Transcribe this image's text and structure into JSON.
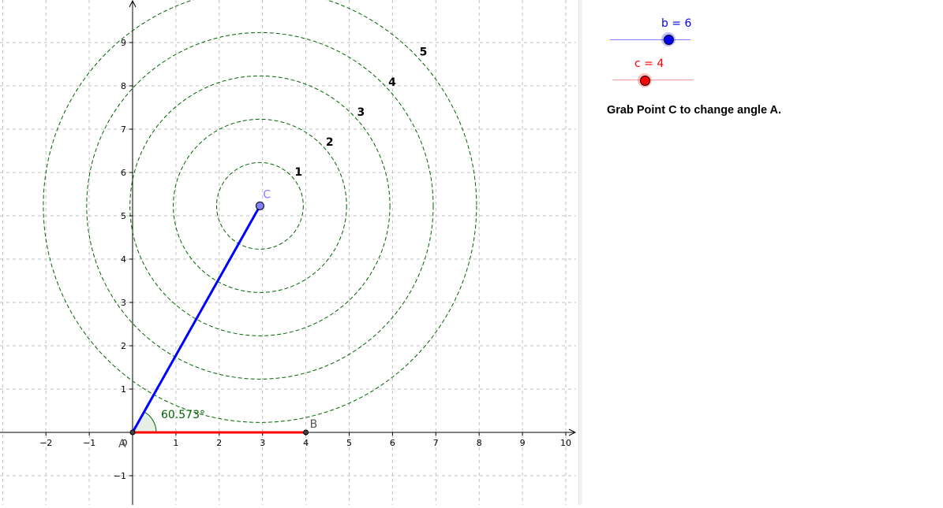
{
  "graph": {
    "x_axis_labels": [
      "−2",
      "−1",
      "1",
      "2",
      "3",
      "4",
      "5",
      "6",
      "7",
      "8",
      "9",
      "10"
    ],
    "x_axis_values": [
      -2,
      -1,
      1,
      2,
      3,
      4,
      5,
      6,
      7,
      8,
      9,
      10
    ],
    "y_axis_labels": [
      "−1",
      "1",
      "2",
      "3",
      "4",
      "5",
      "6",
      "7",
      "8",
      "9"
    ],
    "y_axis_values": [
      -1,
      1,
      2,
      3,
      4,
      5,
      6,
      7,
      8,
      9
    ],
    "origin_label": "0",
    "points": {
      "A": {
        "label": "A",
        "x": 0,
        "y": 0
      },
      "B": {
        "label": "B",
        "x": 4,
        "y": 0
      },
      "C": {
        "label": "C",
        "x": 2.94,
        "y": 5.23
      }
    },
    "angle_label": "60.573°",
    "circles": {
      "center_x": 2.94,
      "center_y": 5.23,
      "radii": [
        1,
        2,
        3,
        4,
        5
      ],
      "labels": [
        "1",
        "2",
        "3",
        "4",
        "5"
      ]
    },
    "colors": {
      "segment_b": "#0000ff",
      "segment_c": "#ff0000",
      "circles": "#006400",
      "angle": "#006400",
      "point_c": "#7f7fff",
      "grid": "#c0c0c0"
    }
  },
  "sliders": {
    "b": {
      "label": "b = 6",
      "value": 6,
      "color": "#0000ff"
    },
    "c": {
      "label": "c = 4",
      "value": 4,
      "color": "#ff0000"
    }
  },
  "instruction": "Grab Point C to change angle A."
}
